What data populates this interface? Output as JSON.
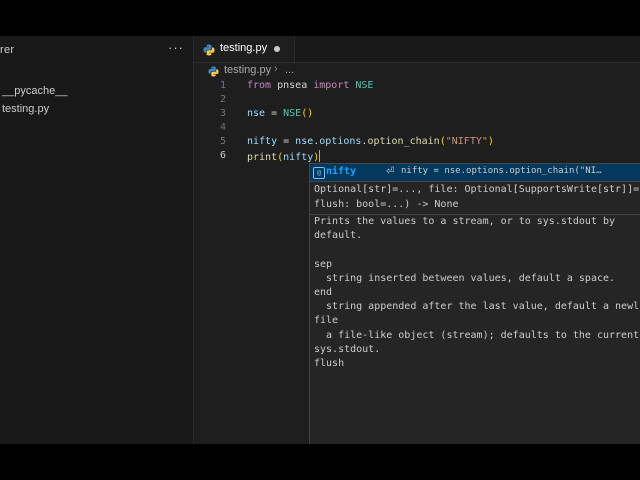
{
  "sidebar": {
    "title": "rer",
    "more": "···",
    "items": [
      {
        "label": "__pycache__"
      },
      {
        "label": "testing.py"
      }
    ]
  },
  "tab": {
    "label": "testing.py",
    "dirty": true
  },
  "breadcrumb": {
    "file": "testing.py",
    "separator": "›",
    "more": "..."
  },
  "editor": {
    "line_numbers": [
      "1",
      "2",
      "3",
      "4",
      "5",
      "6"
    ],
    "active_line": "6",
    "lines": {
      "l1": {
        "kw1": "from",
        "mod": " pnsea ",
        "kw2": "import",
        "cls": " NSE"
      },
      "l3": {
        "var": "nse",
        "eq": " = ",
        "cls": "NSE",
        "open": "(",
        "close": ")"
      },
      "l4": {
        "var": "nifty",
        "eq": " = ",
        "var2": "nse",
        "dot1": ".",
        "attr": "options",
        "dot2": ".",
        "fn": "option_chain",
        "open": "(",
        "str": "\"NIFTY\"",
        "close": ")"
      },
      "l6": {
        "fn": "print",
        "open": "(",
        "arg": "nifty",
        "close": ")"
      }
    }
  },
  "suggestion": {
    "icon": "[@]",
    "label": "nifty",
    "enter_glyph": "⏎",
    "detail": "nifty = nse.options.option_chain(\"NI…"
  },
  "hover": {
    "signature": [
      "Optional[str]=..., file: Optional[SupportsWrite[str]]=...,",
      "flush: bool=...) -> None"
    ],
    "doc": [
      "Prints the values to a stream, or to sys.stdout by",
      "default.",
      "",
      "sep",
      "  string inserted between values, default a space.",
      "end",
      "  string appended after the last value, default a newline.",
      "file",
      "  a file-like object (stream); defaults to the current",
      "sys.stdout.",
      "flush"
    ]
  },
  "colors": {
    "editor_bg": "#1e1e1e",
    "sidebar_bg": "#181818",
    "keyword": "#c586c0",
    "function": "#dcdcaa",
    "string": "#ce9178",
    "variable": "#9cdcfe",
    "class": "#4ec9b0",
    "suggest_highlight": "#04395e"
  },
  "icons": [
    "python-file-icon",
    "symbol-variable-icon",
    "more-icon",
    "chevron-right-icon"
  ]
}
